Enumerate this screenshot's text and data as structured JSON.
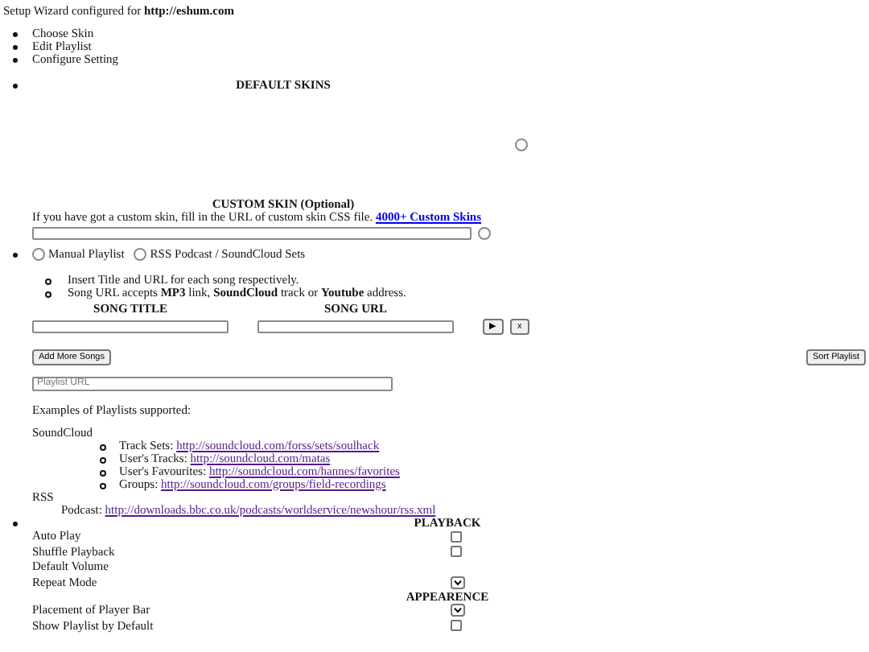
{
  "header": "Setup Wizard configured for **http://eshum.com**",
  "steps": [
    "Choose Skin",
    "Edit Playlist",
    "Configure Setting"
  ],
  "skins": {
    "title": "DEFAULT SKINS",
    "default_selected": false,
    "custom_title": "CUSTOM SKIN (Optional)",
    "custom_text": "If you have got a custom skin, fill in the URL of custom skin CSS file.",
    "custom_link": "4000+ Custom Skins",
    "custom_selected": false
  },
  "playlist_modes": [
    {
      "label": "Manual Playlist",
      "selected": false
    },
    {
      "label": "RSS Podcast / SoundCloud Sets",
      "selected": false
    }
  ],
  "hints": [
    "Insert Title and URL for each song respectively.",
    "Song URL accepts **MP3** link, **SoundCloud** track or **Youtube** address."
  ],
  "song_columns": [
    "SONG TITLE",
    "SONG URL"
  ],
  "row_buttons": [
    {
      "kind": "play",
      "label": "▶"
    },
    {
      "kind": "remove",
      "label": "x"
    }
  ],
  "add_button": "Add More Songs",
  "sort_button": "Sort Playlist",
  "playlist_url": {
    "placeholder": "Playlist URL"
  },
  "examples_title": "Examples of Playlists supported:",
  "soundcloud": {
    "label": "SoundCloud",
    "items": [
      {
        "label": "Track Sets:",
        "link": "http://soundcloud.com/forss/sets/soulhack"
      },
      {
        "label": "User's Tracks:",
        "link": "http://soundcloud.com/matas"
      },
      {
        "label": "User's Favourites:",
        "link": "http://soundcloud.com/hannes/favorites"
      },
      {
        "label": "Groups:",
        "link": "http://soundcloud.com/groups/field-recordings"
      }
    ]
  },
  "rss": {
    "label": "RSS",
    "label_item": "Podcast:",
    "link": "http://downloads.bbc.co.uk/podcasts/worldservice/newshour/rss.xml"
  },
  "settings": [
    {
      "title": "PLAYBACK",
      "rows": [
        {
          "label": "Auto Play",
          "kind": "checkbox",
          "checked": false
        },
        {
          "label": "Shuffle Playback",
          "kind": "checkbox",
          "checked": false
        },
        {
          "label": "Default Volume",
          "kind": "none"
        },
        {
          "label": "Repeat Mode",
          "kind": "select"
        }
      ]
    },
    {
      "title": "APPEARENCE",
      "rows": [
        {
          "label": "Placement of Player Bar",
          "kind": "select"
        },
        {
          "label": "Show Playlist by Default",
          "kind": "checkbox",
          "checked": false
        }
      ]
    }
  ]
}
